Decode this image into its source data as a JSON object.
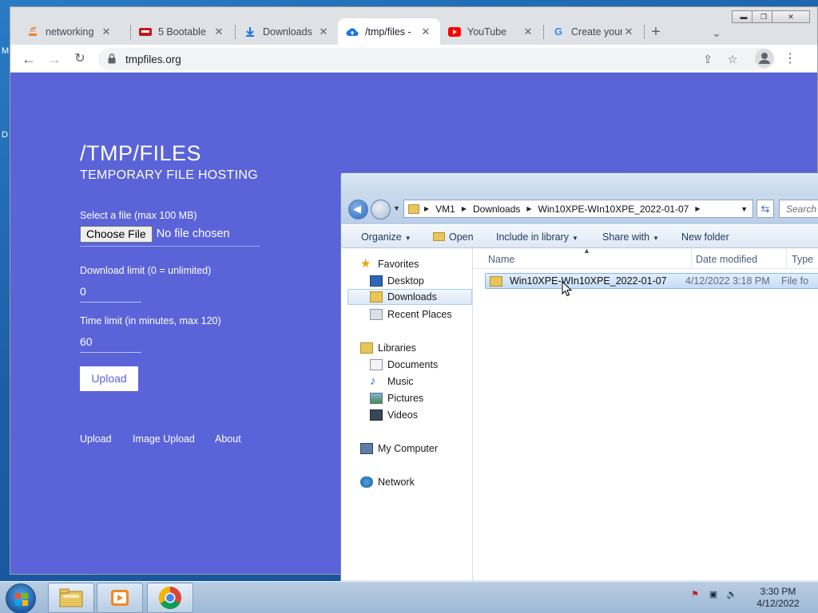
{
  "desktop": {
    "frag_top": "M",
    "frag_mid": "D"
  },
  "chrome": {
    "tabs": [
      {
        "title": "networking",
        "icon": "stack-icon"
      },
      {
        "title": "5 Bootable",
        "icon": "site-icon"
      },
      {
        "title": "Downloads",
        "icon": "download-icon"
      },
      {
        "title": "/tmp/files -",
        "icon": "cloud-upload-icon"
      },
      {
        "title": "YouTube",
        "icon": "youtube-icon"
      },
      {
        "title": "Create your",
        "icon": "google-icon"
      }
    ],
    "url": "tmpfiles.org"
  },
  "site": {
    "title": "/TMP/FILES",
    "subtitle": "TEMPORARY FILE HOSTING",
    "file_label": "Select a file (max 100 MB)",
    "choose_label": "Choose File",
    "no_file": "No file chosen",
    "dl_label": "Download limit (0 = unlimited)",
    "dl_value": "0",
    "time_label": "Time limit (in minutes, max 120)",
    "time_value": "60",
    "upload_label": "Upload",
    "footer": [
      "Upload",
      "Image Upload",
      "About"
    ]
  },
  "explorer": {
    "breadcrumb": [
      "VM1",
      "Downloads",
      "Win10XPE-WIn10XPE_2022-01-07"
    ],
    "search_placeholder": "Search",
    "commands": [
      "Organize",
      "Open",
      "Include in library",
      "Share with",
      "New folder"
    ],
    "tree": {
      "favorites": "Favorites",
      "fav_items": [
        "Desktop",
        "Downloads",
        "Recent Places"
      ],
      "libraries": "Libraries",
      "lib_items": [
        "Documents",
        "Music",
        "Pictures",
        "Videos"
      ],
      "computer": "My Computer",
      "network": "Network"
    },
    "columns": [
      "Name",
      "Date modified",
      "Type"
    ],
    "files": [
      {
        "name": "Win10XPE-WIn10XPE_2022-01-07",
        "date": "4/12/2022 3:18 PM",
        "type": "File fo"
      }
    ]
  },
  "taskbar": {
    "time": "3:30 PM",
    "date": "4/12/2022"
  }
}
